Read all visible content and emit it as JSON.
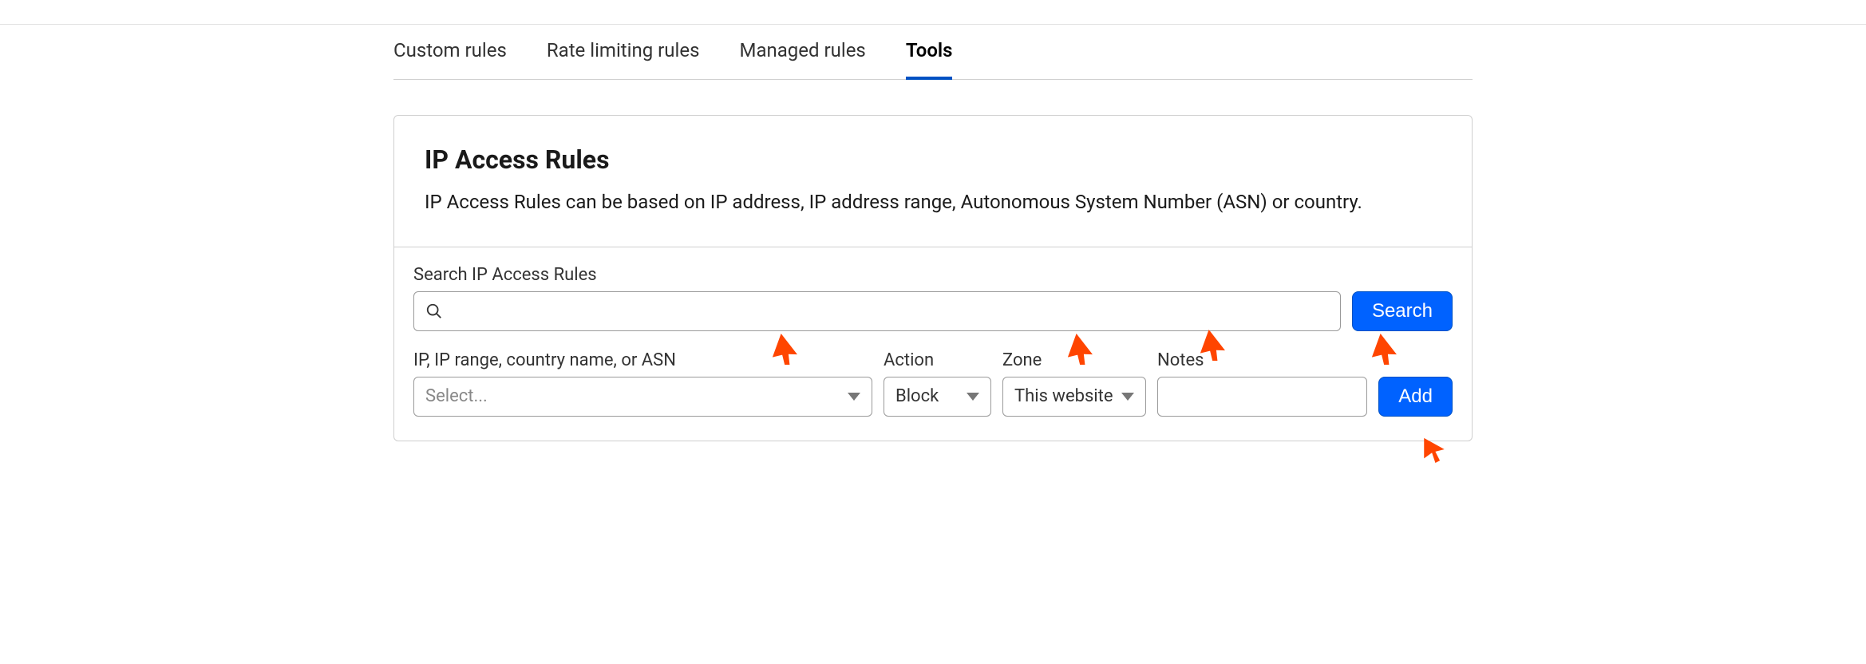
{
  "tabs": {
    "custom": "Custom rules",
    "rate": "Rate limiting rules",
    "managed": "Managed rules",
    "tools": "Tools"
  },
  "panel": {
    "title": "IP Access Rules",
    "description": "IP Access Rules can be based on IP address, IP address range, Autonomous System Number (ASN) or country."
  },
  "search": {
    "label": "Search IP Access Rules",
    "placeholder": "",
    "button": "Search"
  },
  "form": {
    "ip_label": "IP, IP range, country name, or ASN",
    "ip_placeholder": "Select...",
    "action_label": "Action",
    "action_value": "Block",
    "zone_label": "Zone",
    "zone_value": "This website",
    "notes_label": "Notes",
    "notes_value": "",
    "add_button": "Add"
  }
}
